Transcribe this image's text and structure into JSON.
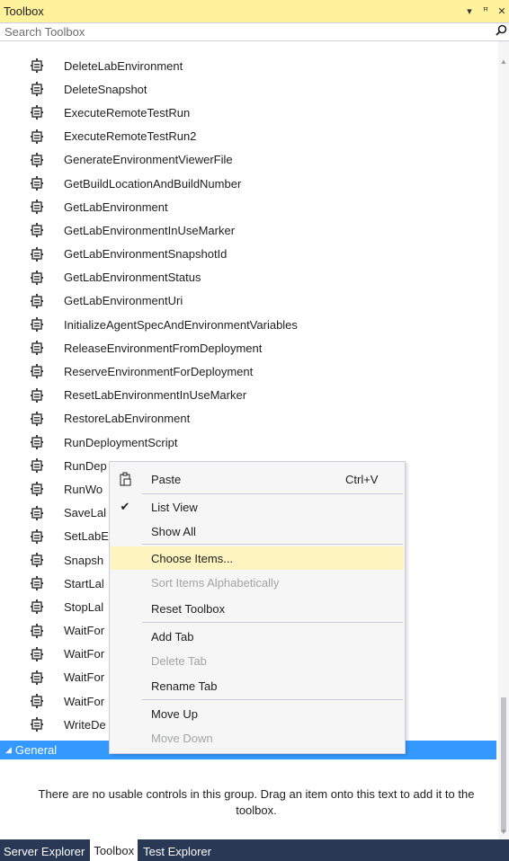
{
  "window": {
    "title": "Toolbox",
    "controls": [
      "▾",
      "ꟸ",
      "✕"
    ]
  },
  "search": {
    "placeholder": "Search Toolbox"
  },
  "items": [
    {
      "label": "DeleteLabEnvironment"
    },
    {
      "label": "DeleteSnapshot"
    },
    {
      "label": "ExecuteRemoteTestRun"
    },
    {
      "label": "ExecuteRemoteTestRun2"
    },
    {
      "label": "GenerateEnvironmentViewerFile"
    },
    {
      "label": "GetBuildLocationAndBuildNumber"
    },
    {
      "label": "GetLabEnvironment"
    },
    {
      "label": "GetLabEnvironmentInUseMarker"
    },
    {
      "label": "GetLabEnvironmentSnapshotId"
    },
    {
      "label": "GetLabEnvironmentStatus"
    },
    {
      "label": "GetLabEnvironmentUri"
    },
    {
      "label": "InitializeAgentSpecAndEnvironmentVariables"
    },
    {
      "label": "ReleaseEnvironmentFromDeployment"
    },
    {
      "label": "ReserveEnvironmentForDeployment"
    },
    {
      "label": "ResetLabEnvironmentInUseMarker"
    },
    {
      "label": "RestoreLabEnvironment"
    },
    {
      "label": "RunDeploymentScript"
    },
    {
      "label": "RunDep"
    },
    {
      "label": "RunWo"
    },
    {
      "label": "SaveLal"
    },
    {
      "label": "SetLabE"
    },
    {
      "label": "Snapsh"
    },
    {
      "label": "StartLal"
    },
    {
      "label": "StopLal"
    },
    {
      "label": "WaitFor"
    },
    {
      "label": "WaitFor"
    },
    {
      "label": "WaitFor"
    },
    {
      "label": "WaitFor"
    },
    {
      "label": "WriteDe"
    }
  ],
  "group": {
    "label": "General",
    "empty_message": "There are no usable controls in this group. Drag an item onto this text to add it to the toolbox."
  },
  "tabs": [
    {
      "label": "Server Explorer"
    },
    {
      "label": "Toolbox"
    },
    {
      "label": "Test Explorer"
    }
  ],
  "context_menu": {
    "items": [
      {
        "label": "Paste",
        "shortcut": "Ctrl+V",
        "icon": "paste-icon",
        "enabled": true
      },
      {
        "label": "List View",
        "icon": "checkmark-icon",
        "checked": true,
        "enabled": true
      },
      {
        "label": "Show All",
        "enabled": true
      },
      {
        "label": "Choose Items...",
        "enabled": true,
        "highlighted": true
      },
      {
        "label": "Sort Items Alphabetically",
        "enabled": false
      },
      {
        "label": "Reset Toolbox",
        "enabled": true
      },
      {
        "label": "Add Tab",
        "enabled": true
      },
      {
        "label": "Delete Tab",
        "enabled": false
      },
      {
        "label": "Rename Tab",
        "enabled": true
      },
      {
        "label": "Move Up",
        "enabled": true
      },
      {
        "label": "Move Down",
        "enabled": false
      }
    ]
  },
  "colors": {
    "title_bar": "#fff29d",
    "group_header": "#3399ff",
    "tab_bar": "#293955",
    "menu_highlight": "#fdf4bf"
  }
}
